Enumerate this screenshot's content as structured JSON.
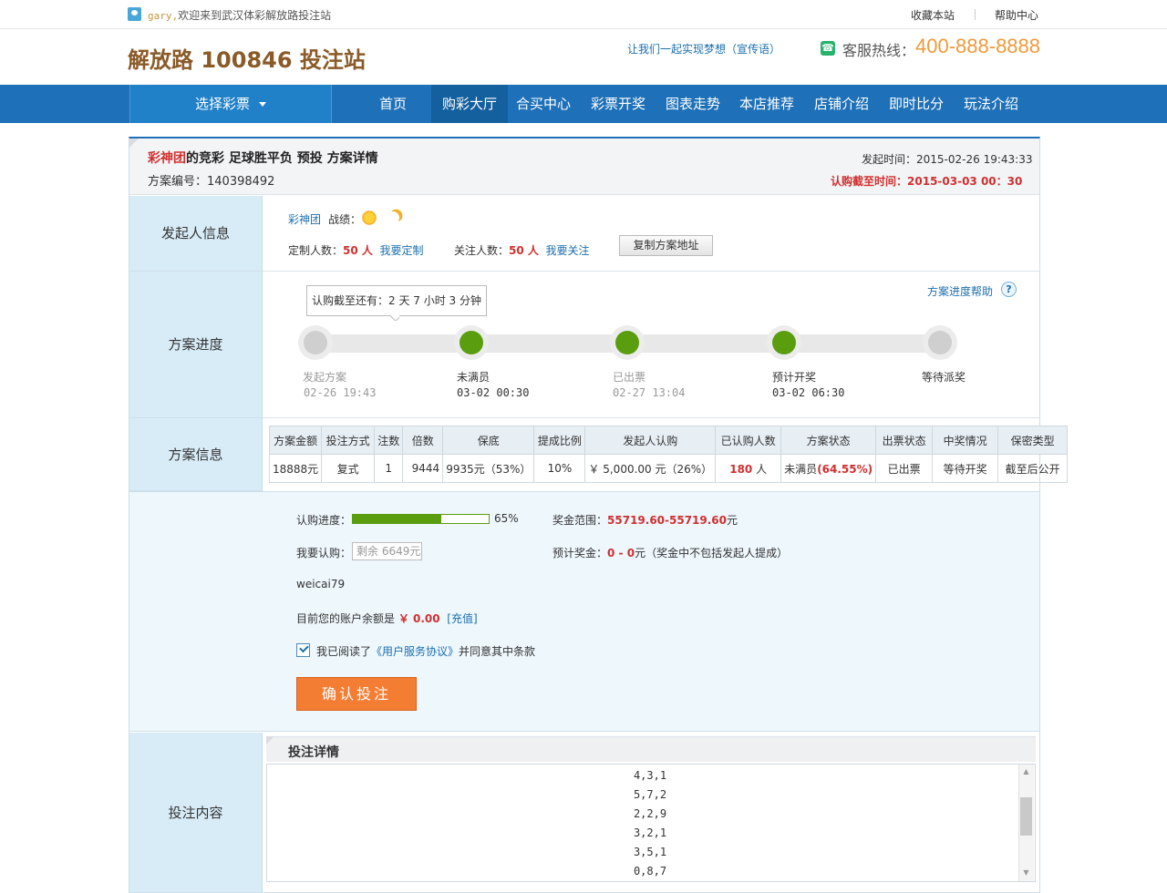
{
  "topbar": {
    "username": "gary,",
    "welcome": "欢迎来到武汉体彩解放路投注站",
    "favorite": "收藏本站",
    "help": "帮助中心"
  },
  "header": {
    "site_title": "解放路 100846 投注站",
    "slogan": "让我们一起实现梦想（宣传语）",
    "hotline_label": "客服热线：",
    "hotline": "400-888-8888"
  },
  "nav": {
    "select_label": "选择彩票",
    "items": [
      "首页",
      "购彩大厅",
      "合买中心",
      "彩票开奖",
      "图表走势",
      "本店推荐",
      "店铺介绍",
      "即时比分",
      "玩法介绍"
    ],
    "active": "购彩大厅"
  },
  "plan": {
    "group_name": "彩神团",
    "title_rest": "的竞彩  足球胜平负  预投  方案详情",
    "plan_no_label": "方案编号：",
    "plan_no": "140398492",
    "launch_time_label": "发起时间：",
    "launch_time": "2015-02-26  19:43:33",
    "deadline_label": "认购截至时间：",
    "deadline": "2015-03-03  00：30"
  },
  "rows": {
    "sponsor": "发起人信息",
    "progress": "方案进度",
    "info": "方案信息",
    "content": "投注内容"
  },
  "sponsor": {
    "name": "彩神团",
    "record_label": "战绩：",
    "custom_label": "定制人数：",
    "custom_count": "50 人",
    "custom_link": "我要定制",
    "follow_label": "关注人数：",
    "follow_count": "50 人",
    "follow_link": "我要关注",
    "copy_button": "复制方案地址"
  },
  "progress": {
    "help_link": "方案进度帮助",
    "help_icon_text": "?",
    "tooltip": "认购截至还有：2 天 7 小时 3 分钟",
    "steps": [
      {
        "label": "发起方案",
        "date": "02-26  19:43",
        "done": false
      },
      {
        "label": "未满员",
        "date": "03-02  00:30",
        "done": true
      },
      {
        "label": "已出票",
        "date": "02-27  13:04",
        "done": true
      },
      {
        "label": "预计开奖",
        "date": "03-02  06:30",
        "done": true
      },
      {
        "label": "等待派奖",
        "date": "",
        "done": false
      }
    ]
  },
  "info_table": {
    "headers": [
      "方案金额",
      "投注方式",
      "注数",
      "倍数",
      "保底",
      "提成比例",
      "发起人认购",
      "已认购人数",
      "方案状态",
      "出票状态",
      "中奖情况",
      "保密类型"
    ],
    "row": {
      "amount": "18888元",
      "method": "复式",
      "bets": "1",
      "multiple": "9444",
      "guarantee": "9935元（53%）",
      "commission": "10%",
      "sponsor_buy": "￥ 5,000.00 元（26%）",
      "buyers_count": "180",
      "buyers_unit": " 人",
      "status_text": "未满员",
      "status_pct": "(64.55%)",
      "ticket_status": "已出票",
      "prize_status": "等待开奖",
      "secrecy": "截至后公开"
    }
  },
  "subscribe": {
    "progress_label": "认购进度：",
    "progress_value": 0.65,
    "progress_text": "65%",
    "prize_range_label": "奖金范围：",
    "prize_range": "55719.60-55719.60",
    "prize_unit": "元",
    "buy_label": "我要认购：",
    "buy_placeholder": "剩余 6649元",
    "est_prize_label": "预计奖金：",
    "est_prize_value": "0 -  0",
    "est_prize_note": "元（奖金中不包括发起人提成）",
    "account_user": "weicai79",
    "balance_label": "目前您的账户余额是",
    "balance": "￥ 0.00",
    "recharge": "[充值]",
    "agree_pre": "我已阅读了",
    "agree_link": "《用户服务协议》",
    "agree_post": "并同意其中条款",
    "confirm_button": "确认投注"
  },
  "bet_detail": {
    "title": "投注详情",
    "lines": [
      "4,3,1",
      "5,7,2",
      "2,2,9",
      "3,2,1",
      "3,5,1",
      "0,8,7"
    ]
  },
  "colors": {
    "nav_bg": "#1e70b8",
    "accent_red": "#d03030",
    "link_blue": "#1d6fae",
    "progress_green": "#5a9e10",
    "confirm_orange": "#f47d34",
    "hotline_orange": "#f09a3a"
  }
}
